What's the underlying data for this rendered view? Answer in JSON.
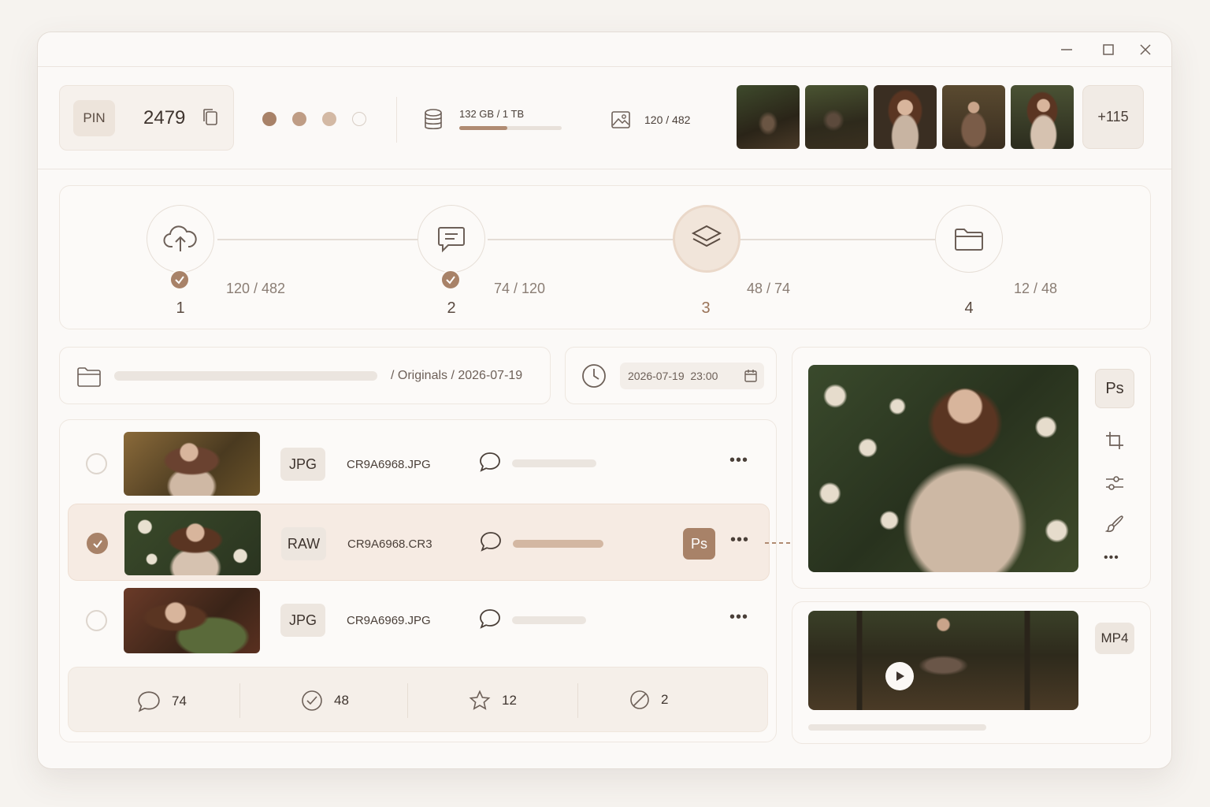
{
  "header": {
    "pin_label": "PIN",
    "pin_value": "2479",
    "rating_dots": [
      "#a88268",
      "#bf9d85",
      "#d3b9a4",
      "empty"
    ],
    "storage_text": "132 GB / 1 TB",
    "storage_progress": 0.47,
    "image_count": "120 / 482",
    "more_thumbs": "+115"
  },
  "workflow": {
    "steps": [
      {
        "num": "1",
        "count": "120 / 482",
        "icon": "cloud-upload-icon",
        "done": true
      },
      {
        "num": "2",
        "count": "74 / 120",
        "icon": "chat-icon",
        "done": true
      },
      {
        "num": "3",
        "count": "48 / 74",
        "icon": "layers-icon",
        "active": true
      },
      {
        "num": "4",
        "count": "12 / 48",
        "icon": "folder-icon"
      }
    ]
  },
  "path": {
    "text": "/ Originals / 2026-07-19"
  },
  "datetime": {
    "value": "2026-07-19  23:00"
  },
  "files": [
    {
      "format": "JPG",
      "name": "CR9A6968.JPG",
      "selected": false,
      "progress": 0.35
    },
    {
      "format": "RAW",
      "name": "CR9A6968.CR3",
      "selected": true,
      "progress": 0.38,
      "editor": "Ps"
    },
    {
      "format": "JPG",
      "name": "CR9A6969.JPG",
      "selected": false,
      "progress": 0.31
    }
  ],
  "stats": {
    "comments": "74",
    "approved": "48",
    "starred": "12",
    "rejected": "2"
  },
  "preview": {
    "editor_label": "Ps",
    "video_format": "MP4"
  },
  "colors": {
    "accent": "#a88268",
    "accent_light": "#d3b7a2",
    "background": "#f6f3ef"
  }
}
